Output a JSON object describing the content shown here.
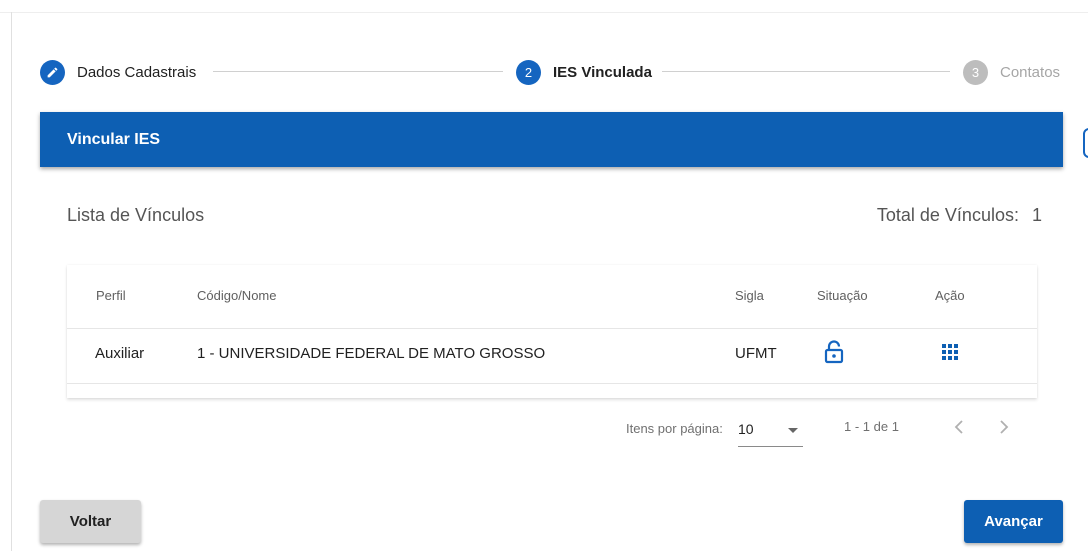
{
  "stepper": {
    "steps": [
      {
        "number": "",
        "label": "Dados Cadastrais",
        "icon": "pencil-icon",
        "state": "done"
      },
      {
        "number": "2",
        "label": "IES Vinculada",
        "state": "active"
      },
      {
        "number": "3",
        "label": "Contatos",
        "state": "inactive"
      }
    ]
  },
  "panel": {
    "title": "Vincular IES"
  },
  "list": {
    "title": "Lista de Vínculos",
    "total_label": "Total de Vínculos:",
    "total_value": "1"
  },
  "table": {
    "headers": {
      "perfil": "Perfil",
      "codigo_nome": "Código/Nome",
      "sigla": "Sigla",
      "situacao": "Situação",
      "acao": "Ação"
    },
    "rows": [
      {
        "perfil": "Auxiliar",
        "codigo_nome": "1 - UNIVERSIDADE FEDERAL DE MATO GROSSO",
        "sigla": "UFMT",
        "situacao_icon": "unlock-icon",
        "acao_icon": "grid-menu-icon"
      }
    ]
  },
  "paginator": {
    "items_label": "Itens por página:",
    "page_size": "10",
    "range": "1 - 1 de 1"
  },
  "buttons": {
    "back": "Voltar",
    "next": "Avançar"
  },
  "colors": {
    "primary": "#0d5fb3",
    "step_inactive": "#bdbdbd"
  }
}
